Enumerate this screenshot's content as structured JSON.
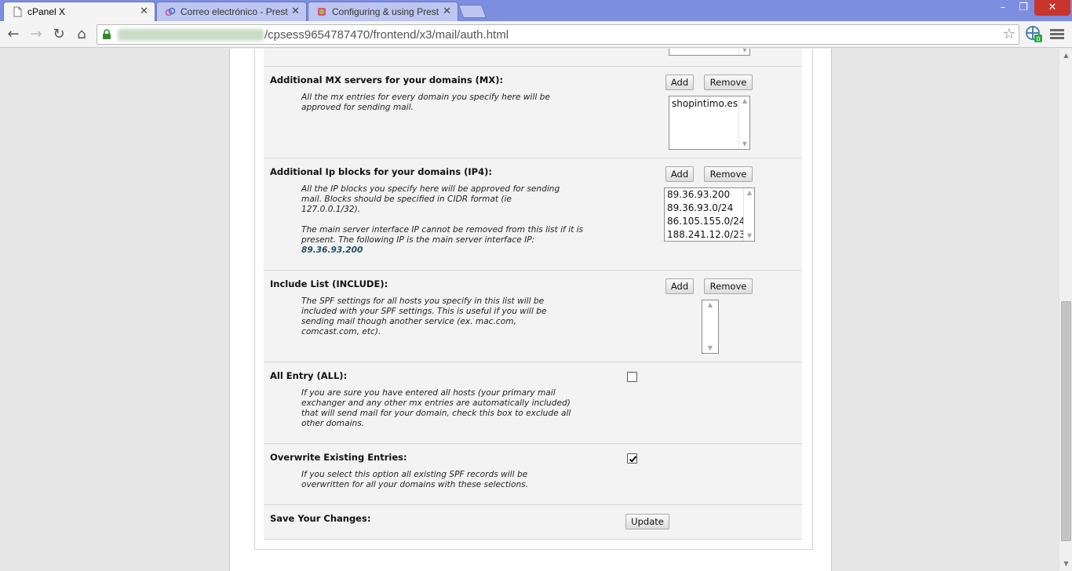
{
  "browser": {
    "tabs": [
      {
        "title": "cPanel X",
        "active": true
      },
      {
        "title": "Correo electrónico - Prest",
        "active": false
      },
      {
        "title": "Configuring & using Prest",
        "active": false
      }
    ],
    "url_path": "/cpsess9654787470/frontend/x3/mail/auth.html",
    "window_controls": {
      "minimize": "–",
      "maximize": "❐",
      "close": "✕"
    },
    "nav": {
      "back": "←",
      "forward": "→",
      "reload": "↻",
      "home": "⌂"
    },
    "bookmark_icon": "☆",
    "extension_badge": "0"
  },
  "spf": {
    "mx": {
      "label": "Additional MX servers for your domains (MX):",
      "description": "All the mx entries for every domain you specify here will be approved for sending mail.",
      "add": "Add",
      "remove": "Remove",
      "entries": [
        "shopintimo.es"
      ]
    },
    "ip4": {
      "label": "Additional Ip blocks for your domains (IP4):",
      "description": "All the IP blocks you specify here will be approved for sending mail. Blocks should be specified in CIDR format (ie 127.0.0.1/32).",
      "note": "The main server interface IP cannot be removed from this list if it is present. The following IP is the main server interface IP:",
      "main_ip": "89.36.93.200",
      "add": "Add",
      "remove": "Remove",
      "entries": [
        "89.36.93.200",
        "89.36.93.0/24",
        "86.105.155.0/24",
        "188.241.12.0/23"
      ]
    },
    "include": {
      "label": "Include List (INCLUDE):",
      "description": "The SPF settings for all hosts you specify in this list will be included with your SPF settings. This is useful if you will be sending mail though another service (ex. mac.com, comcast.com, etc).",
      "add": "Add",
      "remove": "Remove"
    },
    "all": {
      "label": "All Entry (ALL):",
      "description": "If you are sure you have entered all hosts (your primary mail exchanger and any other mx entries are automatically included) that will send mail for your domain, check this box to exclude all other domains.",
      "checked": false
    },
    "overwrite": {
      "label": "Overwrite Existing Entries:",
      "description": "If you select this option all existing SPF records will be overwritten for all your domains with these selections.",
      "checked": true
    },
    "save": {
      "label": "Save Your Changes:",
      "button": "Update"
    }
  }
}
